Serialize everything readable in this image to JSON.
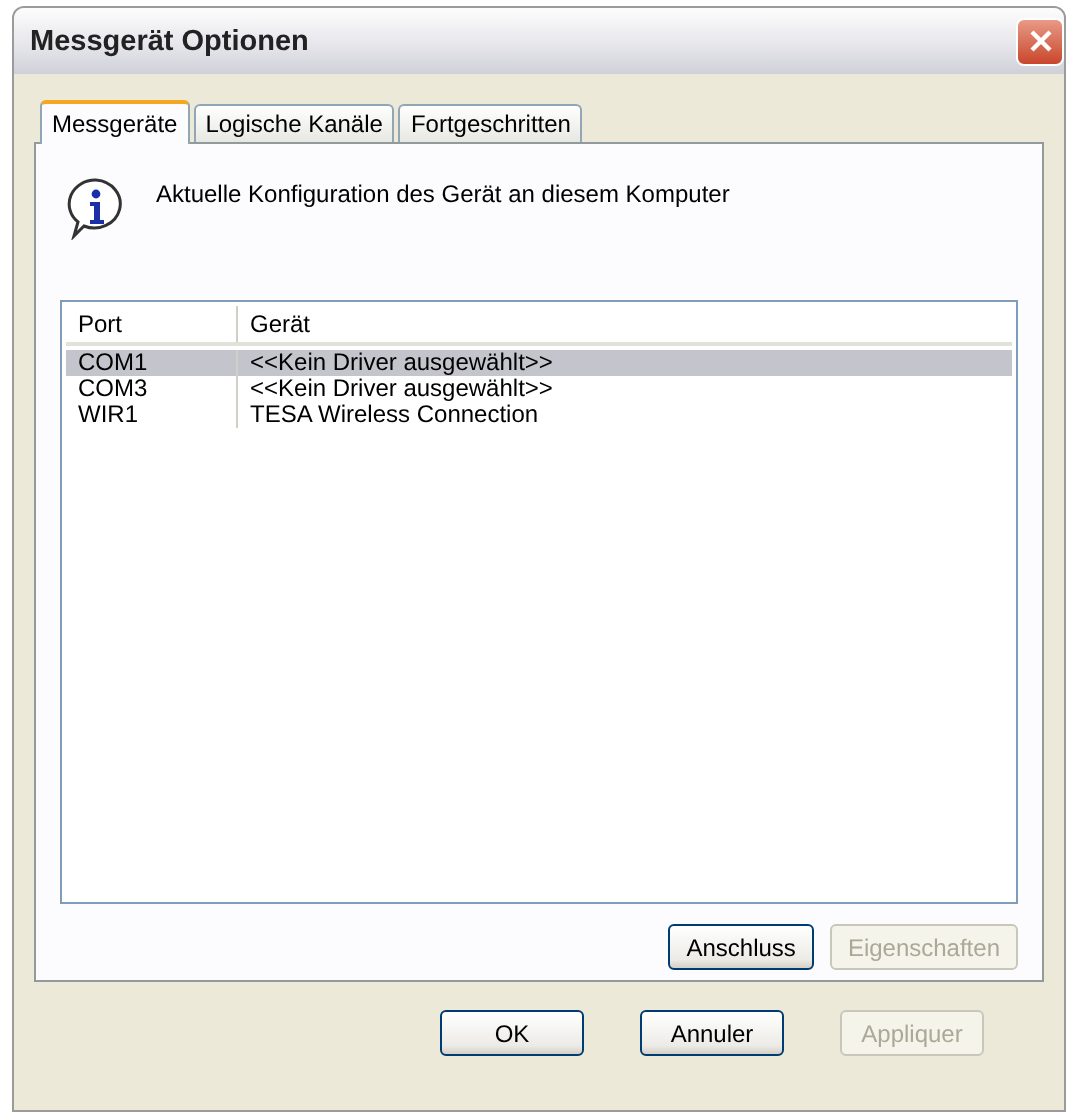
{
  "window": {
    "title": "Messgerät Optionen"
  },
  "tabs": [
    {
      "label": "Messgeräte",
      "selected": true
    },
    {
      "label": "Logische Kanäle",
      "selected": false
    },
    {
      "label": "Fortgeschritten",
      "selected": false
    }
  ],
  "info": "Aktuelle Konfiguration des Gerät an diesem Komputer",
  "table": {
    "columns": [
      "Port",
      "Gerät"
    ],
    "rows": [
      {
        "cells": [
          "COM1",
          "<<Kein Driver ausgewählt>>"
        ],
        "selected": true
      },
      {
        "cells": [
          "COM3",
          "<<Kein Driver ausgewählt>>"
        ],
        "selected": false
      },
      {
        "cells": [
          "WIR1",
          "TESA Wireless Connection"
        ],
        "selected": false
      }
    ]
  },
  "panel_buttons": [
    {
      "label": "Anschluss",
      "disabled": false
    },
    {
      "label": "Eigenschaften",
      "disabled": true
    }
  ],
  "buttons": [
    {
      "label": "OK",
      "disabled": false
    },
    {
      "label": "Annuler",
      "disabled": false
    },
    {
      "label": "Appliquer",
      "disabled": true
    }
  ]
}
